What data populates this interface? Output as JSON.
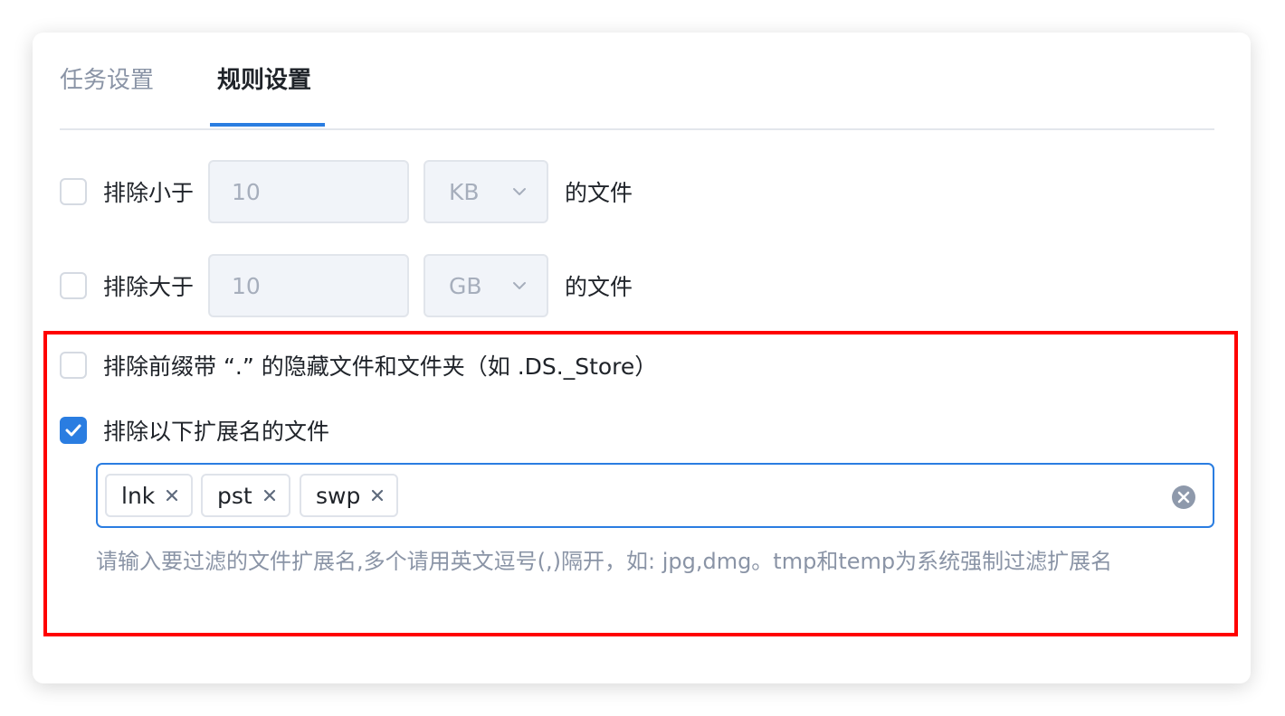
{
  "tabs": {
    "task": "任务设置",
    "rules": "规则设置"
  },
  "rules": {
    "min_size": {
      "label": "排除小于",
      "value": "10",
      "unit": "KB",
      "suffix": "的文件",
      "checked": false
    },
    "max_size": {
      "label": "排除大于",
      "value": "10",
      "unit": "GB",
      "suffix": "的文件",
      "checked": false
    },
    "hidden_files": {
      "label": "排除前缀带 “.” 的隐藏文件和文件夹（如 .DS._Store）",
      "checked": false
    },
    "extensions": {
      "label": "排除以下扩展名的文件",
      "checked": true,
      "tags": [
        "lnk",
        "pst",
        "swp"
      ],
      "hint": "请输入要过滤的文件扩展名,多个请用英文逗号(,)隔开，如: jpg,dmg。tmp和temp为系统强制过滤扩展名"
    }
  },
  "icons": {
    "checkbox_check": "check-icon",
    "select_arrow": "chevron-down-icon",
    "tag_remove": "close-icon",
    "clear": "clear-circle-icon"
  },
  "colors": {
    "accent": "#2a7de1",
    "highlight": "#ff0000",
    "muted_text": "#8a94a6"
  }
}
